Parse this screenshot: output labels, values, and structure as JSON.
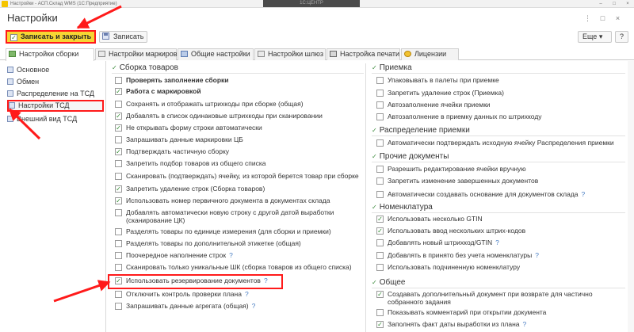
{
  "window": {
    "title": "Настройки - АСП.Склад WMS (1С:Предприятие)",
    "center_text": "1С:ЦЕНТР",
    "controls": [
      "–",
      "□",
      "×"
    ]
  },
  "page": {
    "title": "Настройки",
    "header_controls": [
      "⋮",
      "□",
      "×"
    ]
  },
  "toolbar": {
    "save_close_label": "Записать и закрыть",
    "save_label": "Записать",
    "more_label": "Еще ▾",
    "help_label": "?"
  },
  "tabs": [
    {
      "label": "Настройки сборки",
      "icon": "assembly-icon",
      "active": true
    },
    {
      "label": "Настройки маркировки",
      "icon": "marking-icon",
      "active": false
    },
    {
      "label": "Общие настройки",
      "icon": "settings-icon",
      "active": false
    },
    {
      "label": "Настройки шлюз",
      "icon": "gateway-icon",
      "active": false
    },
    {
      "label": "Настройка печати",
      "icon": "printer-icon",
      "active": false
    },
    {
      "label": "Лицензии",
      "icon": "license-icon",
      "active": false
    }
  ],
  "nav": [
    {
      "label": "Основное",
      "selected": false
    },
    {
      "label": "Обмен",
      "selected": false
    },
    {
      "label": "Распределение на ТСД",
      "selected": false
    },
    {
      "label": "Настройки ТСД",
      "selected": true
    },
    {
      "label": "Внешний вид ТСД",
      "selected": false
    }
  ],
  "left_section": {
    "title": "Сборка товаров",
    "items": [
      {
        "label": "Проверять заполнение сборки",
        "checked": false,
        "bold": true,
        "help": false
      },
      {
        "label": "Работа с маркировкой",
        "checked": true,
        "bold": true,
        "help": false
      },
      {
        "label": "Сохранять  и отображать штрихкоды при сборке (общая)",
        "checked": false,
        "bold": false,
        "help": false
      },
      {
        "label": "Добавлять в список одинаковые штрихкоды при сканировании",
        "checked": true,
        "bold": false,
        "help": false
      },
      {
        "label": "Не открывать форму строки автоматически",
        "checked": true,
        "bold": false,
        "help": false
      },
      {
        "label": "Запрашивать данные маркировки ЦБ",
        "checked": false,
        "bold": false,
        "help": false
      },
      {
        "label": "Подтверждать частичную сборку",
        "checked": true,
        "bold": false,
        "help": false
      },
      {
        "label": "Запретить подбор товаров из общего списка",
        "checked": false,
        "bold": false,
        "help": false
      },
      {
        "label": "Сканировать (подтверждать) ячейку, из которой берется товар при сборке",
        "checked": false,
        "bold": false,
        "help": false
      },
      {
        "label": "Запретить удаление строк (Сборка товаров)",
        "checked": true,
        "bold": false,
        "help": false
      },
      {
        "label": "Использовать номер первичного документа в документах склада",
        "checked": true,
        "bold": false,
        "help": false
      },
      {
        "label": "Добавлять автоматически новую строку с другой датой выработки",
        "label2": "(сканирование ЦК)",
        "checked": false,
        "bold": false,
        "help": false
      },
      {
        "label": "Разделять товары по единице измерения (для сборки и приемки)",
        "checked": false,
        "bold": false,
        "help": false
      },
      {
        "label": "Разделять товары по дополнительной этикетке (общая)",
        "checked": false,
        "bold": false,
        "help": false
      },
      {
        "label": "Поочередное наполнение строк",
        "checked": false,
        "bold": false,
        "help": true
      },
      {
        "label": "Сканировать только уникальные ШК (сборка товаров из общего списка)",
        "checked": false,
        "bold": false,
        "help": false
      },
      {
        "label": "Использовать резервирование документов",
        "checked": true,
        "bold": false,
        "help": true
      },
      {
        "label": "Отключить контроль проверки плана",
        "checked": false,
        "bold": false,
        "help": true
      },
      {
        "label": "Запрашивать данные агрегата (общая)",
        "checked": false,
        "bold": false,
        "help": true
      }
    ]
  },
  "right_sections": [
    {
      "title": "Приемка",
      "items": [
        {
          "label": "Упаковывать в палеты при приемке",
          "checked": false,
          "help": false
        },
        {
          "label": "Запретить удаление строк (Приемка)",
          "checked": false,
          "help": false
        },
        {
          "label": "Автозаполнение ячейки приемки",
          "checked": false,
          "help": false
        },
        {
          "label": "Автозаполнение в приемку данных по штрихкоду",
          "checked": false,
          "help": false
        }
      ]
    },
    {
      "title": "Распределение приемки",
      "items": [
        {
          "label": "Автоматически подтверждать исходную ячейку Распределения приемки",
          "checked": false,
          "help": false
        }
      ]
    },
    {
      "title": "Прочие документы",
      "items": [
        {
          "label": "Разрешить редактирование ячейки вручную",
          "checked": false,
          "help": false
        },
        {
          "label": "Запретить изменение завершенных документов",
          "checked": false,
          "help": false
        },
        {
          "label": "Автоматически создавать основание для документов склада",
          "checked": false,
          "help": true
        }
      ]
    },
    {
      "title": "Номенклатура",
      "items": [
        {
          "label": "Использовать несколько GTIN",
          "checked": true,
          "help": false
        },
        {
          "label": "Использовать ввод нескольких штрих-кодов",
          "checked": true,
          "help": false
        },
        {
          "label": "Добавлять новый штрихкод/GTIN",
          "checked": false,
          "help": true
        },
        {
          "label": "Добавлять в принято без учета номенклатуры",
          "checked": false,
          "help": true
        },
        {
          "label": "Использовать подчиненную номенклатуру",
          "checked": false,
          "help": false
        }
      ]
    },
    {
      "title": "Общее",
      "items": [
        {
          "label": "Создавать дополнительный документ при возврате для частично",
          "label2": "собранного задания",
          "checked": true,
          "help": false
        },
        {
          "label": "Показывать комментарий при открытии документа",
          "checked": false,
          "help": false
        },
        {
          "label": "Заполнять факт даты выработки из плана",
          "checked": true,
          "help": true
        }
      ]
    }
  ],
  "colors": {
    "accent_yellow": "#f6d634",
    "annotation_red": "#ff1a1a",
    "check_green": "#2f8a2f",
    "help_blue": "#4a7fc4"
  }
}
